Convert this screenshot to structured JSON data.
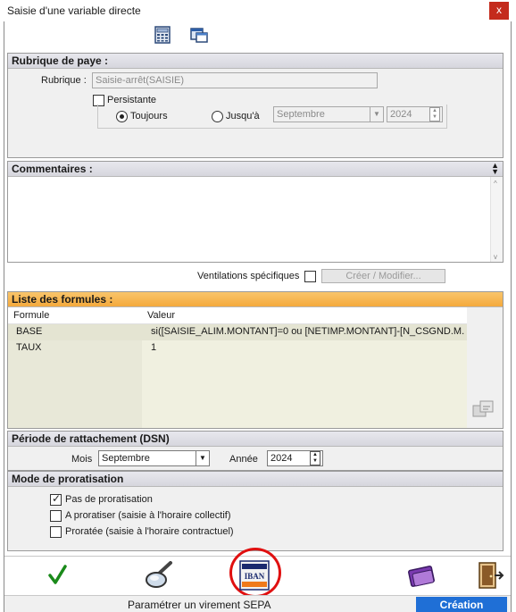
{
  "window": {
    "title": "Saisie d'une variable directe",
    "close_glyph": "x"
  },
  "toolbar": {
    "icons": [
      "calculator-icon",
      "window-layout-icon"
    ]
  },
  "rubrique_panel": {
    "header": "Rubrique de paye :",
    "rubrique_label": "Rubrique :",
    "rubrique_value": "Saisie-arrêt(SAISIE)",
    "persistante_label": "Persistante",
    "persistante_checked": false,
    "toujours_label": "Toujours",
    "jusqua_label": "Jusqu'à",
    "selected_radio": "Toujours",
    "month_value": "Septembre",
    "year_value": "2024"
  },
  "commentaires_panel": {
    "header": "Commentaires :",
    "ventilations_label": "Ventilations spécifiques",
    "ventilations_checked": false,
    "create_button": "Créer / Modifier..."
  },
  "formules_panel": {
    "header": "Liste des formules :",
    "columns": [
      "Formule",
      "Valeur"
    ],
    "rows": [
      {
        "formule": "BASE",
        "valeur": "si([SAISIE_ALIM.MONTANT]=0 ou [NETIMP.MONTANT]-[N_CSGND.M..."
      },
      {
        "formule": "TAUX",
        "valeur": "1"
      }
    ]
  },
  "periode_panel": {
    "header": "Période de rattachement (DSN)",
    "mois_label": "Mois",
    "mois_value": "Septembre",
    "annee_label": "Année",
    "annee_value": "2024"
  },
  "proratisation_panel": {
    "header": "Mode de proratisation",
    "options": [
      {
        "label": "Pas de proratisation",
        "checked": true
      },
      {
        "label": "A proratiser (saisie à l'horaire collectif)",
        "checked": false
      },
      {
        "label": "Proratée (saisie à l'horaire contractuel)",
        "checked": false
      }
    ]
  },
  "bottom_toolbar": {
    "icons": [
      "validate-check-icon",
      "search-magnifier-icon",
      "iban-sepa-icon",
      "edit-card-icon",
      "exit-door-icon"
    ],
    "highlight_color": "#e01010"
  },
  "status_bar": {
    "text": "Paramétrer un virement SEPA",
    "mode": "Création",
    "mode_color": "#1f6fd6"
  }
}
